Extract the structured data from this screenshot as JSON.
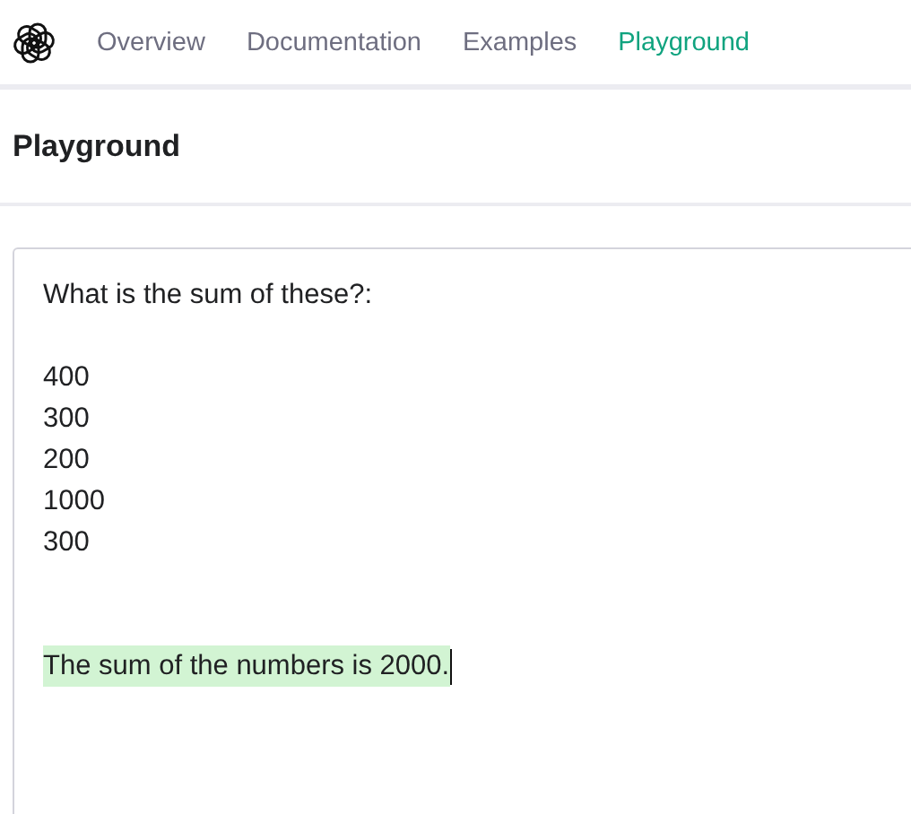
{
  "nav": {
    "items": [
      {
        "label": "Overview",
        "selected": false
      },
      {
        "label": "Documentation",
        "selected": false
      },
      {
        "label": "Examples",
        "selected": false
      },
      {
        "label": "Playground",
        "selected": true
      }
    ]
  },
  "page_title": "Playground",
  "editor": {
    "blocks": [
      {
        "kind": "prompt",
        "lines": [
          "What is the sum of these?:"
        ]
      },
      {
        "kind": "prompt",
        "lines": [
          "400",
          "300",
          "200",
          "1000",
          "300"
        ]
      },
      {
        "kind": "completion",
        "lines": [
          "The sum of the numbers is 2000."
        ]
      }
    ]
  }
}
